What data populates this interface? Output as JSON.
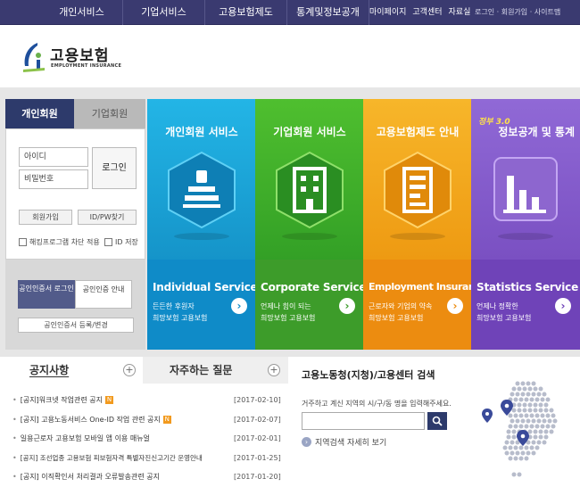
{
  "top_nav": [
    "개인서비스",
    "기업서비스",
    "고용보험제도",
    "통계및정보공개"
  ],
  "utility": [
    "마이페이지",
    "고객센터",
    "자료실"
  ],
  "utility_sub": "로그인 · 회원가입 · 사이트맵",
  "logo": {
    "name": "고용보험",
    "sub": "EMPLOYMENT INSURANCE"
  },
  "login": {
    "tab_personal": "개인회원",
    "tab_business": "기업회원",
    "id_placeholder": "아이디",
    "pw_placeholder": "비밀번호",
    "login_button": "로그인",
    "join_button": "회원가입",
    "find_button": "ID/PW찾기",
    "check_block": "해킹프로그램 차단 적용",
    "check_save_id": "ID 저장",
    "cert_login": "공인인증서 로그인",
    "cert_info": "공인인증 안내",
    "cert_register": "공인인증서 등록/변경"
  },
  "tiles": [
    {
      "title": "개인회원 서비스",
      "en": "Individual Service",
      "line1": "든든한 후원자",
      "line2": "희망보험 고용보험"
    },
    {
      "title": "기업회원 서비스",
      "en": "Corporate Service",
      "line1": "언제나 힘이 되는",
      "line2": "희망보험 고용보험"
    },
    {
      "title": "고용보험제도 안내",
      "en": "Employment Insurance",
      "line1": "근로자와 기업의 약속",
      "line2": "희망보험 고용보험"
    },
    {
      "title": "정보공개 및 통계",
      "badge": "정부 3.0",
      "en": "Statistics Service",
      "line1": "언제나 정확한",
      "line2": "희망보험 고용보험"
    }
  ],
  "tile_colors": [
    "#1aa3d6",
    "#3aa92f",
    "#f0a21a",
    "#7c4bbf"
  ],
  "notice": {
    "tab_notice": "공지사항",
    "tab_faq": "자주하는 질문",
    "items": [
      {
        "title": "[공지]워크넷 작업관련 공지",
        "new": "N",
        "date": "[2017-02-10]"
      },
      {
        "title": "[공지] 고용노동서비스 One-ID 작업 관련 공지",
        "new": "N",
        "date": "[2017-02-07]"
      },
      {
        "title": "일용근로자 고용보험 모바일 앱 이용 매뉴얼",
        "new": "",
        "date": "[2017-02-01]"
      },
      {
        "title": "[공지] 조선업종 고용보험 피보험자격 특별자진신고기간 운영안내",
        "new": "",
        "date": "[2017-01-25]"
      },
      {
        "title": "[공지] 이직확인서 처리결과 오류발송관련 공지",
        "new": "",
        "date": "[2017-01-20]"
      }
    ]
  },
  "search": {
    "title": "고용노동청(지청)/고용센터 검색",
    "desc": "거주하고 계신 지역의 시/구/동 명을 입력해주세요.",
    "more": "지역검색 자세히 보기"
  }
}
